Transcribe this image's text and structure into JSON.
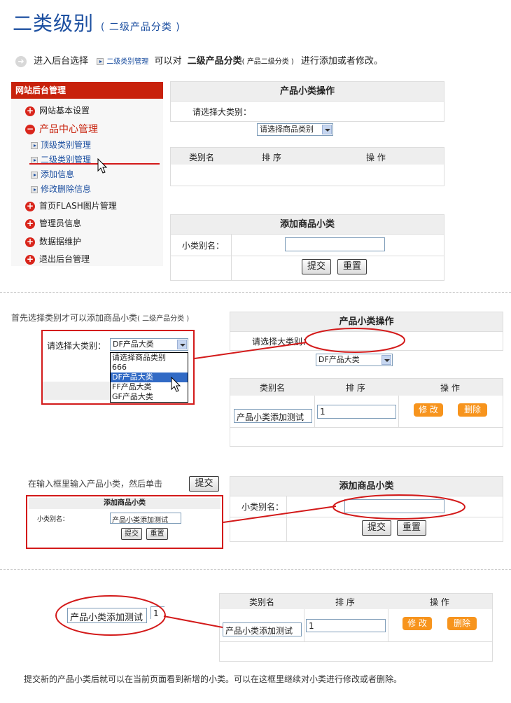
{
  "header": {
    "title": "二类级别",
    "subtitle": "( 二级产品分类 )"
  },
  "intro": {
    "text1": "进入后台选择",
    "link": "二级类别管理",
    "text2": "可以对",
    "bold": "二级产品分类",
    "small": "( 产品二级分类 )",
    "text3": "进行添加或者修改。"
  },
  "sidebar": {
    "header": "网站后台管理",
    "items": [
      {
        "label": "网站基本设置"
      },
      {
        "label": "产品中心管理"
      },
      {
        "label": "顶级类别管理"
      },
      {
        "label": "二级类别管理"
      },
      {
        "label": "添加信息"
      },
      {
        "label": "修改删除信息"
      },
      {
        "label": "首页FLASH图片管理"
      },
      {
        "label": "管理员信息"
      },
      {
        "label": "数据据维护"
      },
      {
        "label": "退出后台管理"
      }
    ]
  },
  "panel_ops": {
    "title": "产品小类操作",
    "select_label": "请选择大类别：",
    "select_value": "请选择商品类别"
  },
  "table_headers": {
    "name": "类别名",
    "order": "排 序",
    "actions": "操 作"
  },
  "panel_add": {
    "title": "添加商品小类",
    "field_label": "小类别名：",
    "submit": "提交",
    "reset": "重置"
  },
  "step1": {
    "caption": "首先选择类别才可以添加商品小类",
    "caption_small": "( 二级产品分类 )",
    "select_label": "请选择大类别：",
    "select_value": "DF产品大类",
    "options": [
      "请选择商品类别",
      "666",
      "DF产品大类",
      "FF产品大类",
      "GF产品大类"
    ]
  },
  "row": {
    "name": "产品小类添加测试",
    "order": "1",
    "edit": "修 改",
    "delete": "删除"
  },
  "step2": {
    "caption": "在输入框里输入产品小类，然后单击",
    "caption_button": "提交",
    "mini_title": "添加商品小类",
    "mini_label": "小类别名：",
    "mini_value": "产品小类添加测试"
  },
  "step3": {
    "zoom_value": "产品小类添加测试",
    "zoom_order": "1",
    "caption": "提交新的产品小类后就可以在当前页面看到新增的小类。可以在这框里继续对小类进行修改或者删除。"
  },
  "colors": {
    "brand_red": "#c8220c",
    "title_blue": "#1c4fa0",
    "orange_button": "#f7941d",
    "annotation_red": "#d31a1a"
  }
}
